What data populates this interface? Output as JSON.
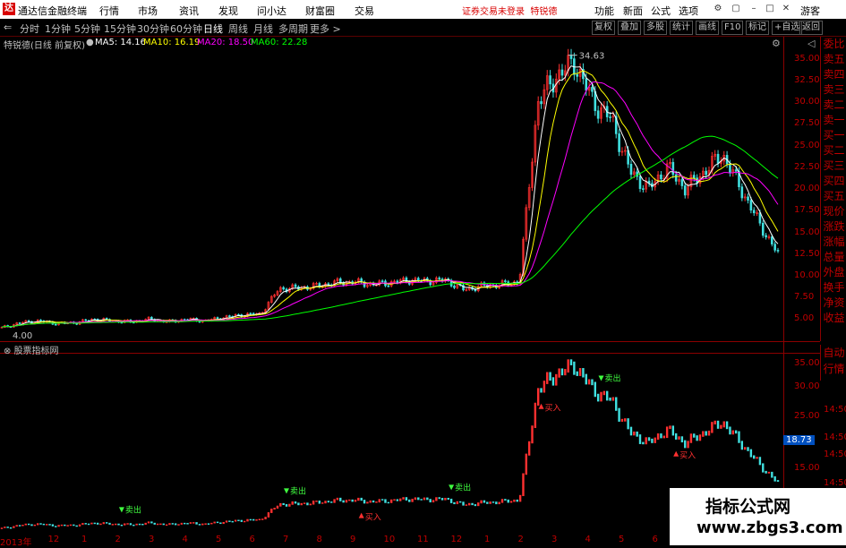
{
  "titlebar": {
    "app": "通达信金融终端",
    "menus": [
      "行情",
      "市场",
      "资讯",
      "发现",
      "问小达",
      "财富圈",
      "交易"
    ],
    "notice_left": "证券交易未登录",
    "notice_right": "特锐德",
    "right_items": [
      "功能",
      "新面",
      "公式",
      "选项"
    ],
    "guest": "游客",
    "logo": "达"
  },
  "toolbar": {
    "periods": [
      "分时",
      "1分钟",
      "5分钟",
      "15分钟",
      "30分钟",
      "60分钟",
      "日线",
      "周线",
      "月线",
      "多周期",
      "更多 >"
    ],
    "active": "日线",
    "right_buttons": [
      "复权",
      "叠加",
      "多股",
      "统计",
      "画线",
      "F10",
      "标记",
      "+自选",
      "返回"
    ]
  },
  "infobar": {
    "stock": "特锐德(日线 前复权)",
    "ma5": "MA5: 14.16",
    "ma10": "MA10: 16.19",
    "ma20": "MA20: 18.50",
    "ma60": "MA60: 22.28"
  },
  "colors": {
    "ma5": "#ffffff",
    "ma10": "#ffff00",
    "ma20": "#ff00ff",
    "ma60": "#00ff00",
    "rise": "#ff3030",
    "fall": "#40e0e0"
  },
  "side_panel": [
    "委比",
    "卖五",
    "卖四",
    "卖三",
    "卖二",
    "卖一",
    "买一",
    "买二",
    "买三",
    "买四",
    "买五",
    "现价",
    "涨跌",
    "涨幅",
    "总量",
    "外盘",
    "换手",
    "净资",
    "收益"
  ],
  "side_panel2": [
    "自动",
    "行情"
  ],
  "main_axis": [
    "35.00",
    "32.50",
    "30.00",
    "27.50",
    "25.00",
    "22.50",
    "20.00",
    "17.50",
    "15.00",
    "12.50",
    "10.00",
    "7.50",
    "5.00"
  ],
  "sub_axis": [
    "35.00",
    "30.00",
    "14:50",
    "25.00",
    "14:50",
    "14:50",
    "15.00",
    "14:50"
  ],
  "peak_label": "34.63",
  "low_label": "4.00",
  "sub_panel_label": "股票指标网",
  "sub_current": "18.73",
  "bottom_axis": [
    "2013年",
    "12",
    "1",
    "2",
    "3",
    "4",
    "5",
    "6",
    "7",
    "8",
    "9",
    "10",
    "11",
    "12",
    "1",
    "2",
    "3",
    "4",
    "5",
    "6"
  ],
  "signals": {
    "buy": "买入",
    "sell": "卖出"
  },
  "watermark": {
    "line1": "指标公式网",
    "line2": "www.zbgs3.com"
  },
  "chart_data": {
    "type": "line",
    "title": "",
    "price_path": [
      4.0,
      4.6,
      4.8,
      4.5,
      4.6,
      5.0,
      4.8,
      4.7,
      5.0,
      4.7,
      5.0,
      4.8,
      5.2,
      5.5,
      5.6,
      8.5,
      8.6,
      8.8,
      9.2,
      9.3,
      9.0,
      9.2,
      9.5,
      9.4,
      9.5,
      8.4,
      8.8,
      9.0,
      9.3,
      30.0,
      33.0,
      34.6,
      30.0,
      28.0,
      22.0,
      20.0,
      22.5,
      20.0,
      22.0,
      24.0,
      20.0,
      16.0,
      12.5
    ],
    "ylim": [
      3.5,
      36.0
    ]
  }
}
